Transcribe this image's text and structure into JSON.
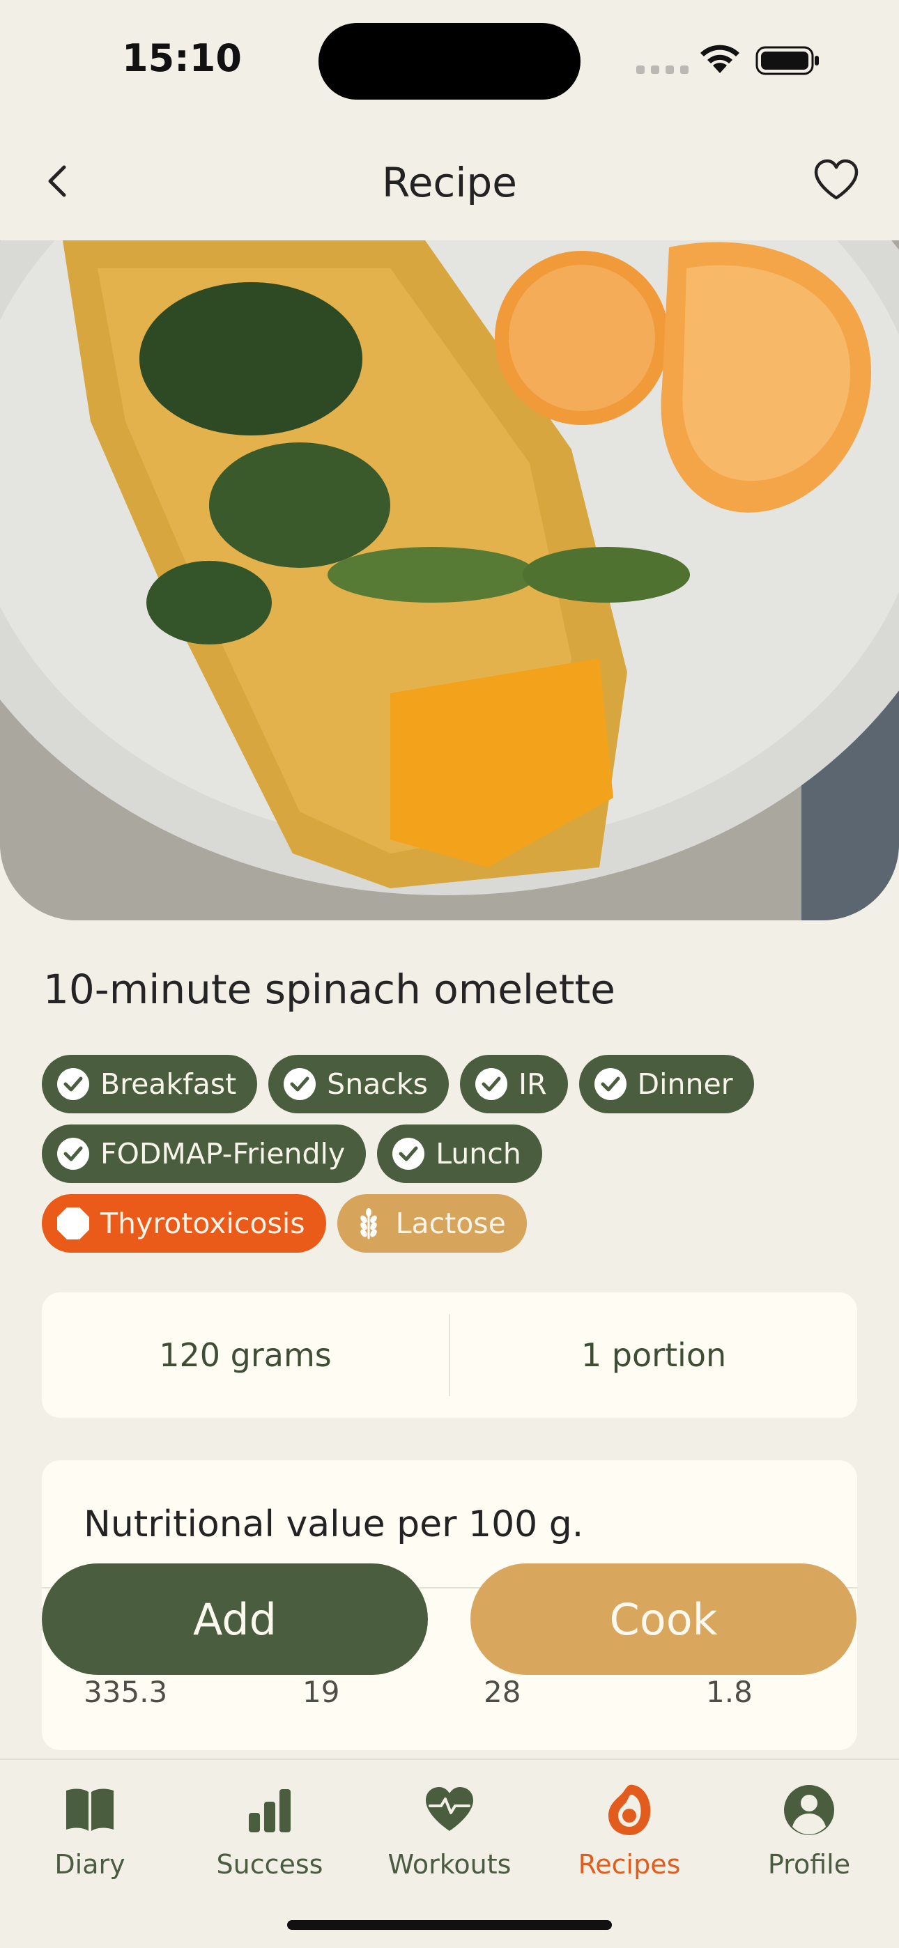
{
  "status_bar": {
    "time": "15:10"
  },
  "header": {
    "title": "Recipe"
  },
  "recipe": {
    "title": "10-minute spinach omelette",
    "tags": [
      {
        "label": "Breakfast",
        "style": "green",
        "icon": "check-icon"
      },
      {
        "label": "Snacks",
        "style": "green",
        "icon": "check-icon"
      },
      {
        "label": "IR",
        "style": "green",
        "icon": "check-icon"
      },
      {
        "label": "Dinner",
        "style": "green",
        "icon": "check-icon"
      },
      {
        "label": "FODMAP-Friendly",
        "style": "green",
        "icon": "check-icon"
      },
      {
        "label": "Lunch",
        "style": "green",
        "icon": "check-icon"
      },
      {
        "label": "Thyrotoxicosis",
        "style": "orange",
        "icon": "stop-octagon-icon"
      },
      {
        "label": "Lactose",
        "style": "tan",
        "icon": "wheat-icon"
      }
    ],
    "portion": {
      "weight": "120 grams",
      "count": "1 portion"
    },
    "nutrition": {
      "title": "Nutritional value per 100 g.",
      "values": [
        "335.3",
        "19",
        "28",
        "1.8"
      ]
    }
  },
  "actions": {
    "add_label": "Add",
    "cook_label": "Cook"
  },
  "tab_bar": {
    "items": [
      {
        "label": "Diary",
        "icon": "book-icon"
      },
      {
        "label": "Success",
        "icon": "bar-chart-icon"
      },
      {
        "label": "Workouts",
        "icon": "heart-pulse-icon"
      },
      {
        "label": "Recipes",
        "icon": "avocado-icon",
        "active": true
      },
      {
        "label": "Profile",
        "icon": "profile-icon"
      }
    ]
  },
  "colors": {
    "background": "#f2f0e6",
    "brand_green": "#4a5e3f",
    "accent_tan": "#d8a65d",
    "alert_orange": "#ea5a18",
    "active_tab": "#e25d1d"
  }
}
